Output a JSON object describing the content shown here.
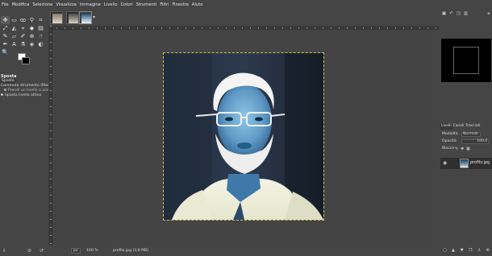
{
  "menubar": {
    "items": [
      "File",
      "Modifica",
      "Selezione",
      "Visualizza",
      "Immagine",
      "Livello",
      "Colori",
      "Strumenti",
      "Filtri",
      "Finestre",
      "Aiuto"
    ]
  },
  "toolbox": {
    "tools": [
      {
        "name": "move-tool-icon",
        "glyph": "✥"
      },
      {
        "name": "rect-select-icon",
        "glyph": "▭"
      },
      {
        "name": "lasso-icon",
        "glyph": "ꝏ"
      },
      {
        "name": "fuzzy-select-icon",
        "glyph": "⚲"
      },
      {
        "name": "crop-icon",
        "glyph": "⌗"
      },
      {
        "name": "transform-icon",
        "glyph": "⤢"
      },
      {
        "name": "warp-icon",
        "glyph": "◭"
      },
      {
        "name": "cage-icon",
        "glyph": "⌖"
      },
      {
        "name": "bucket-icon",
        "glyph": "◆"
      },
      {
        "name": "gradient-icon",
        "glyph": "▤"
      },
      {
        "name": "paintbrush-icon",
        "glyph": "✎"
      },
      {
        "name": "eraser-icon",
        "glyph": "▱"
      },
      {
        "name": "airbrush-icon",
        "glyph": "✐"
      },
      {
        "name": "clone-icon",
        "glyph": "⊕"
      },
      {
        "name": "smudge-icon",
        "glyph": "☝"
      },
      {
        "name": "path-icon",
        "glyph": "✒"
      },
      {
        "name": "text-icon",
        "glyph": "A"
      },
      {
        "name": "color-picker-icon",
        "glyph": "⚗"
      },
      {
        "name": "measure-icon",
        "glyph": "◈"
      },
      {
        "name": "dodge-icon",
        "glyph": "◐"
      },
      {
        "name": "zoom-icon",
        "glyph": "🔍"
      }
    ],
    "options": {
      "title": "Sposta",
      "tab_label": "Sposta",
      "mode_label": "Commuta strumento (Maiusc)",
      "radio1": "Prendi un livello o una",
      "radio2": "Sposta livello attivo"
    }
  },
  "tabs": {
    "dropdown": "▾"
  },
  "status": {
    "unit": "px",
    "zoom": "100 %",
    "file": "profilo.jpg (3,8 MB)"
  },
  "right_panel": {
    "tabs": [
      "Livelli",
      "Canali",
      "Tracciati"
    ],
    "mode_label": "Modalità",
    "mode_value": "Normale",
    "opacity_label": "Opacità",
    "opacity_value": "100,0",
    "lock_label": "Blocca",
    "layer_name": "profilo.jpg"
  }
}
